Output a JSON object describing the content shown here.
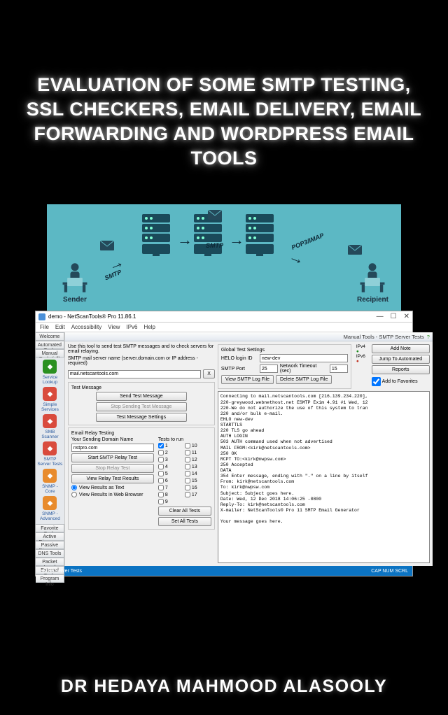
{
  "book": {
    "title": "EVALUATION OF SOME SMTP TESTING, SSL CHECKERS, EMAIL DELIVERY, EMAIL FORWARDING AND WORDPRESS EMAIL TOOLS",
    "author": "DR HEDAYA MAHMOOD ALASOOLY"
  },
  "diagram": {
    "sender_label": "Sender",
    "recipient_label": "Recipient",
    "proto1": "SMTP",
    "proto2": "SMTP",
    "proto3": "POP3/IMAP"
  },
  "window": {
    "title": "demo - NetScanTools® Pro 11.86.1",
    "menu": [
      "File",
      "Edit",
      "Accessibility",
      "View",
      "IPv6",
      "Help"
    ],
    "panel_title": "Manual Tools - SMTP Server Tests",
    "status_left": "SMTP Server Tests",
    "status_right": "CAP  NUM  SCRL"
  },
  "sidebar": {
    "top_tabs": [
      "Welcome",
      "Automated Tools",
      "Manual Tools (all)"
    ],
    "tools": [
      {
        "label": "Service Lookup",
        "color": "green"
      },
      {
        "label": "Simple Services",
        "color": "red"
      },
      {
        "label": "SMB Scanner",
        "color": "red"
      },
      {
        "label": "SMTP Server Tests",
        "color": "red"
      },
      {
        "label": "SNMP - Core",
        "color": "orange"
      },
      {
        "label": "SNMP - Advanced",
        "color": "orange"
      }
    ],
    "bottom_tabs": [
      "Favorite Tools",
      "Active Discovery Tools",
      "Passive Discovery Tools",
      "DNS Tools",
      "Packet Level Tools",
      "External Tools",
      "Program Info"
    ]
  },
  "form": {
    "intro": "Use this tool to send test SMTP messages and to check servers for email relaying.",
    "server_label": "SMTP mail server name (server.domain.com or IP address - required)",
    "server_value": "mail.netscantools.com",
    "x_btn": "X",
    "test_msg_title": "Test Message",
    "send_test_btn": "Send Test Message",
    "stop_send_btn": "Stop Sending Test Message",
    "test_settings_btn": "Test Message Settings",
    "relay_title": "Email Relay Testing",
    "relay_domain_label": "Your Sending Domain Name",
    "relay_domain_value": "nstpro.com",
    "start_relay_btn": "Start SMTP Relay Test",
    "stop_relay_btn": "Stop Relay Test",
    "view_relay_btn": "View Relay Test Results",
    "radio_text": "View Results as Text",
    "radio_browser": "View Results in Web Browser",
    "tests_label": "Tests to run",
    "clear_all_btn": "Clear All Tests",
    "set_all_btn": "Set All Tests"
  },
  "global": {
    "title": "Global Test Settings",
    "helo_label": "HELO login ID",
    "helo_value": "new-dev",
    "port_label": "SMTP Port",
    "port_value": "25",
    "timeout_label": "Network Timeout (sec)",
    "timeout_value": "15",
    "view_log_btn": "View SMTP Log File",
    "delete_log_btn": "Delete SMTP Log File",
    "ipv4": "IPv4",
    "ipv6": "IPv6"
  },
  "right_buttons": {
    "add_note": "Add Note",
    "jump": "Jump To Automated",
    "reports": "Reports",
    "fav": "Add to Favorites"
  },
  "log_text": "Connecting to mail.netscantools.com [216.139.234.220],\n220-greywood.webnethost.net ESMTP Exim 4.91 #1 Wed, 12\n220-We do not authorize the use of this system to tran\n220 and/or bulk e-mail.\nEHLO new-dev\nSTARTTLS\n220 TLS go ahead\nAUTH LOGIN\n503 AUTH command used when not advertised\nMAIL FROM:<kirk@netscantools.com>\n250 OK\nRCPT TO:<kirk@nwpsw.com>\n250 Accepted\nDATA\n354 Enter message, ending with \".\" on a line by itself\nFrom: kirk@netscantools.com\nTo: kirk@nwpsw.com\nSubject: Subject goes here.\nDate: Wed, 12 Dec 2018 14:06:25 -0800\nReply-To: kirk@netscantools.com\nX-mailer: NetScanTools® Pro 11 SMTP Email Generator\n\nYour message goes here.",
  "tests": {
    "count": 17,
    "checked": [
      1
    ]
  }
}
